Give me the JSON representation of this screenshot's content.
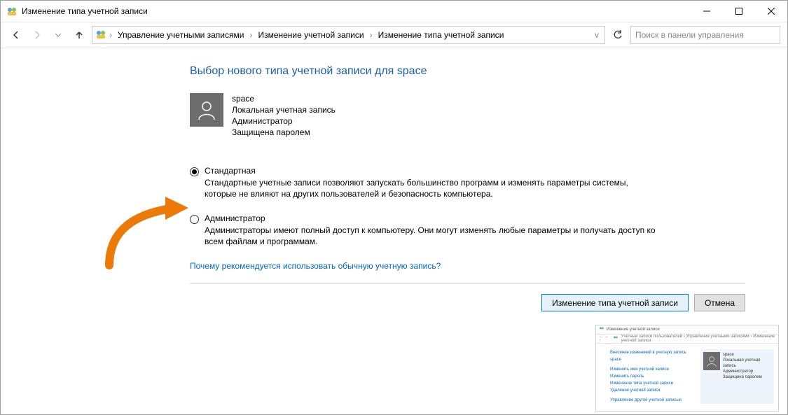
{
  "title": "Изменение типа учетной записи",
  "breadcrumb": {
    "items": [
      "Управление учетными записями",
      "Изменение учетной записи",
      "Изменение типа учетной записи"
    ]
  },
  "search": {
    "placeholder": "Поиск в панели управления"
  },
  "headline": "Выбор нового типа учетной записи для space",
  "user": {
    "name": "space",
    "line1": "Локальная учетная запись",
    "line2": "Администратор",
    "line3": "Защищена паролем"
  },
  "options": {
    "standard": {
      "label": "Стандартная",
      "desc": "Стандартные учетные записи позволяют запускать большинство программ и изменять параметры системы, которые не влияют на других пользователей и безопасность компьютера.",
      "selected": true
    },
    "admin": {
      "label": "Администратор",
      "desc": "Администраторы имеют полный доступ к компьютеру. Они могут изменять любые параметры и получать доступ ко всем файлам и программам.",
      "selected": false
    }
  },
  "help_link": "Почему рекомендуется использовать обычную учетную запись?",
  "buttons": {
    "primary": "Изменение типа учетной записи",
    "cancel": "Отмена"
  },
  "thumb": {
    "title": "Изменение учетной записи",
    "nav": "Учетные записи пользователей  ›  Управление учетными записями  ›  Изменение учетной записи",
    "headline": "Внесение изменений в учетную запись space",
    "links": [
      "Изменить имя учетной записи",
      "Изменить пароль",
      "Изменение типа учетной записи",
      "Удаление учетной записи",
      "Управление другой учетной записью"
    ],
    "user": {
      "name": "space",
      "l1": "Локальная учетная запись",
      "l2": "Администратор",
      "l3": "Защищена паролем"
    }
  }
}
